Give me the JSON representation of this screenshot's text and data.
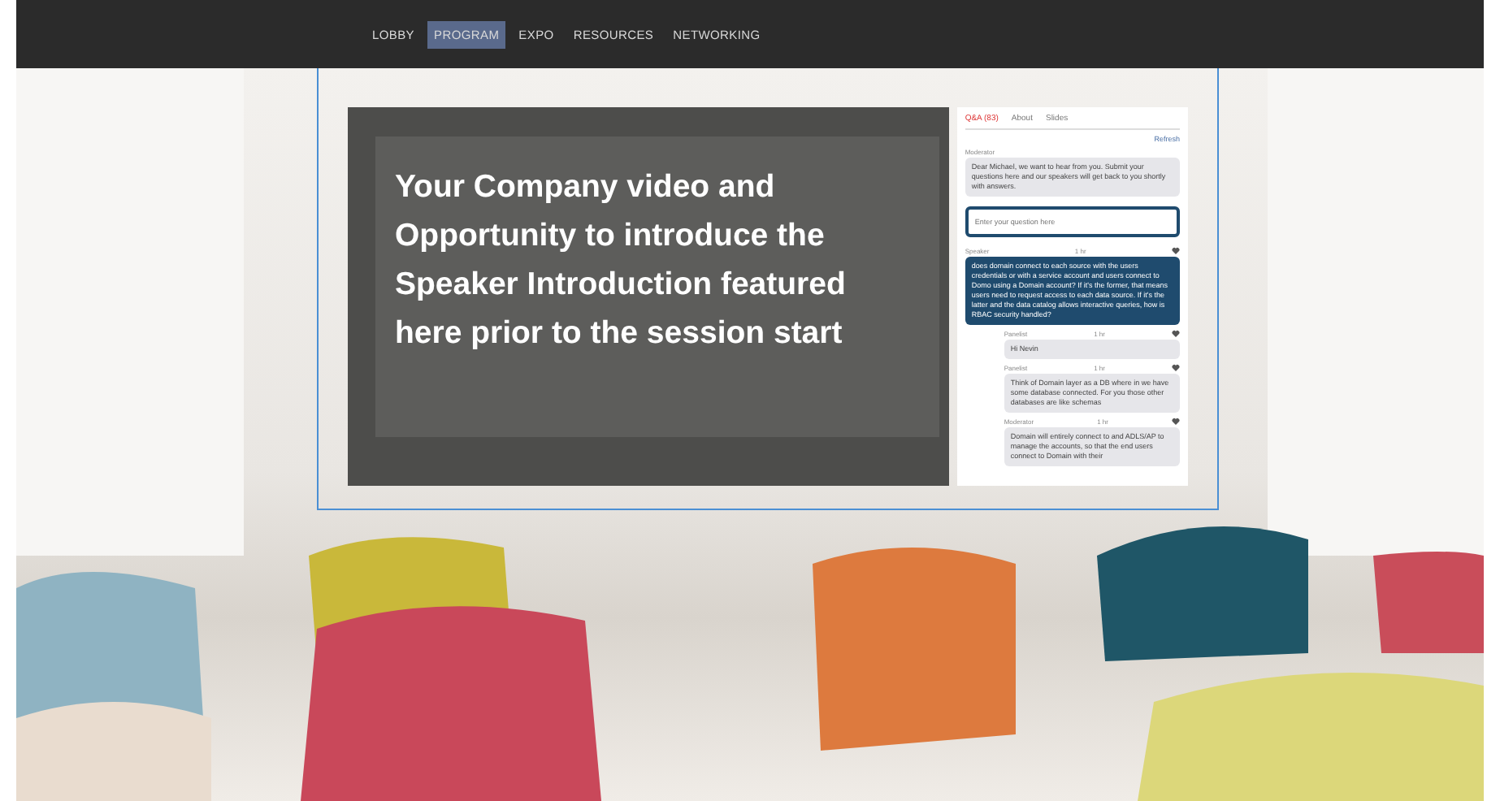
{
  "nav": {
    "items": [
      {
        "label": "LOBBY",
        "selected": false
      },
      {
        "label": "PROGRAM",
        "selected": true
      },
      {
        "label": "EXPO",
        "selected": false
      },
      {
        "label": "RESOURCES",
        "selected": false
      },
      {
        "label": "NETWORKING",
        "selected": false
      }
    ]
  },
  "video": {
    "caption": "Your Company video and Opportunity to introduce the Speaker Introduction featured here prior to the session start"
  },
  "chat": {
    "tabs": [
      {
        "label": "Q&A (83)",
        "selected": true
      },
      {
        "label": "About",
        "selected": false
      },
      {
        "label": "Slides",
        "selected": false
      }
    ],
    "refresh": "Refresh",
    "intro": {
      "author": "Moderator",
      "text": "Dear Michael, we want to hear from you. Submit your questions here and our speakers will get back to you shortly with answers."
    },
    "input": {
      "placeholder": "Enter your question here"
    },
    "messages": [
      {
        "kind": "question",
        "author": "Speaker",
        "time": "1 hr",
        "text": "does domain connect to each source with the users credentials or with a service account and users connect to Domo using a Domain account? If it's the former, that means users need to request access to each data source. If it's the latter and the data catalog allows interactive queries, how is RBAC security handled?"
      },
      {
        "kind": "reply",
        "author": "Panelist",
        "time": "1 hr",
        "text": "Hi Nevin"
      },
      {
        "kind": "reply",
        "author": "Panelist",
        "time": "1 hr",
        "text": "Think of Domain layer as a DB where in we have some database connected. For you those other databases are like schemas"
      },
      {
        "kind": "reply",
        "author": "Moderator",
        "time": "1 hr",
        "text": "Domain will entirely connect to and ADLS/AP to manage the accounts, so that the end users connect to Domain with their"
      }
    ]
  }
}
